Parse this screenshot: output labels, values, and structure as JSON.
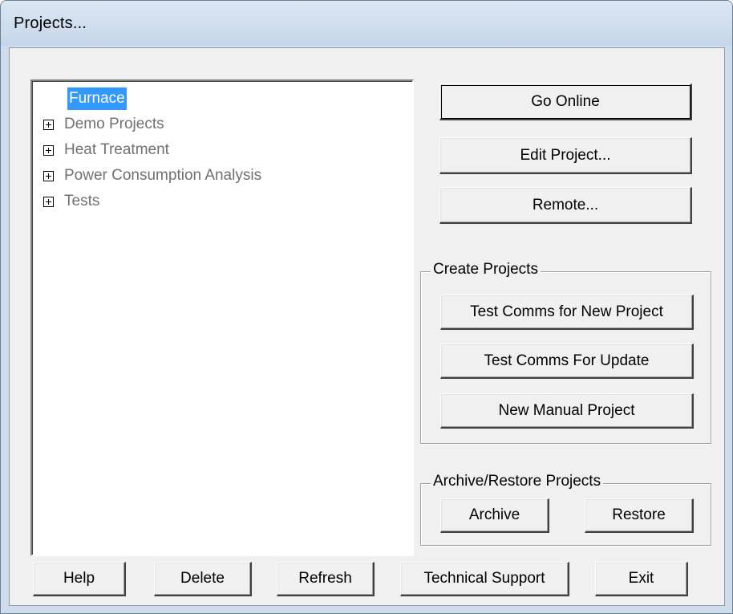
{
  "window": {
    "title": "Projects..."
  },
  "tree": {
    "items": [
      {
        "label": "Furnace",
        "expandable": false,
        "selected": true
      },
      {
        "label": "Demo Projects",
        "expandable": true,
        "selected": false
      },
      {
        "label": "Heat Treatment",
        "expandable": true,
        "selected": false
      },
      {
        "label": "Power Consumption Analysis",
        "expandable": true,
        "selected": false
      },
      {
        "label": "Tests",
        "expandable": true,
        "selected": false
      }
    ]
  },
  "actions": {
    "go_online": "Go Online",
    "edit_project": "Edit Project...",
    "remote": "Remote..."
  },
  "create_projects": {
    "title": "Create Projects",
    "test_comms_new": "Test Comms for New Project",
    "test_comms_update": "Test Comms For Update",
    "new_manual": "New Manual Project"
  },
  "archive_restore": {
    "title": "Archive/Restore Projects",
    "archive": "Archive",
    "restore": "Restore"
  },
  "footer": {
    "help": "Help",
    "delete": "Delete",
    "refresh": "Refresh",
    "technical_support": "Technical Support",
    "exit": "Exit"
  },
  "colors": {
    "selection": "#3399ff",
    "face": "#f0f0f0",
    "frame": "#cfdcec"
  }
}
